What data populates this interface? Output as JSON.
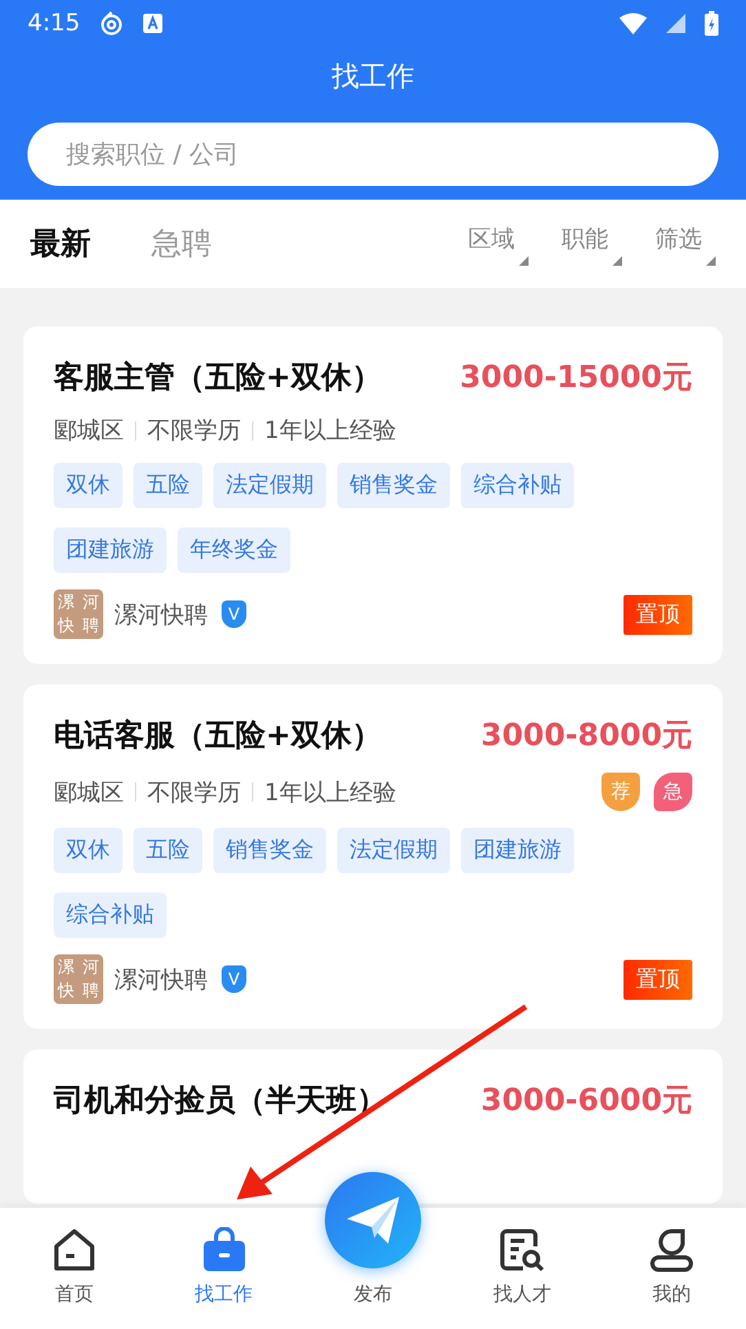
{
  "status_bar": {
    "time": "4:15"
  },
  "header": {
    "title": "找工作"
  },
  "search": {
    "placeholder": "搜索职位 / 公司"
  },
  "tabs": [
    {
      "label": "最新",
      "selected": true
    },
    {
      "label": "急聘",
      "selected": false
    }
  ],
  "filters": [
    {
      "label": "区域"
    },
    {
      "label": "职能"
    },
    {
      "label": "筛选"
    }
  ],
  "jobs": [
    {
      "title": "客服主管（五险+双休）",
      "salary": "3000-15000元",
      "meta": [
        "郾城区",
        "不限学历",
        "1年以上经验"
      ],
      "tags": [
        "双休",
        "五险",
        "法定假期",
        "销售奖金",
        "综合补贴",
        "团建旅游",
        "年终奖金"
      ],
      "company": {
        "logo_text": "漯河快聘",
        "name": "漯河快聘",
        "verified": "V"
      },
      "pinned": "置顶"
    },
    {
      "title": "电话客服（五险+双休）",
      "salary": "3000-8000元",
      "meta": [
        "郾城区",
        "不限学历",
        "1年以上经验"
      ],
      "badges": [
        {
          "kind": "shield",
          "text": "荐"
        },
        {
          "kind": "leaf",
          "text": "急"
        }
      ],
      "tags": [
        "双休",
        "五险",
        "销售奖金",
        "法定假期",
        "团建旅游",
        "综合补贴"
      ],
      "company": {
        "logo_text": "漯河快聘",
        "name": "漯河快聘",
        "verified": "V"
      },
      "pinned": "置顶"
    },
    {
      "title": "司机和分捡员（半天班）",
      "salary": "3000-6000元"
    }
  ],
  "nav": [
    {
      "label": "首页",
      "selected": false
    },
    {
      "label": "找工作",
      "selected": true
    },
    {
      "label": "发布",
      "selected": false,
      "kind": "publish"
    },
    {
      "label": "找人才",
      "selected": false
    },
    {
      "label": "我的",
      "selected": false
    }
  ]
}
